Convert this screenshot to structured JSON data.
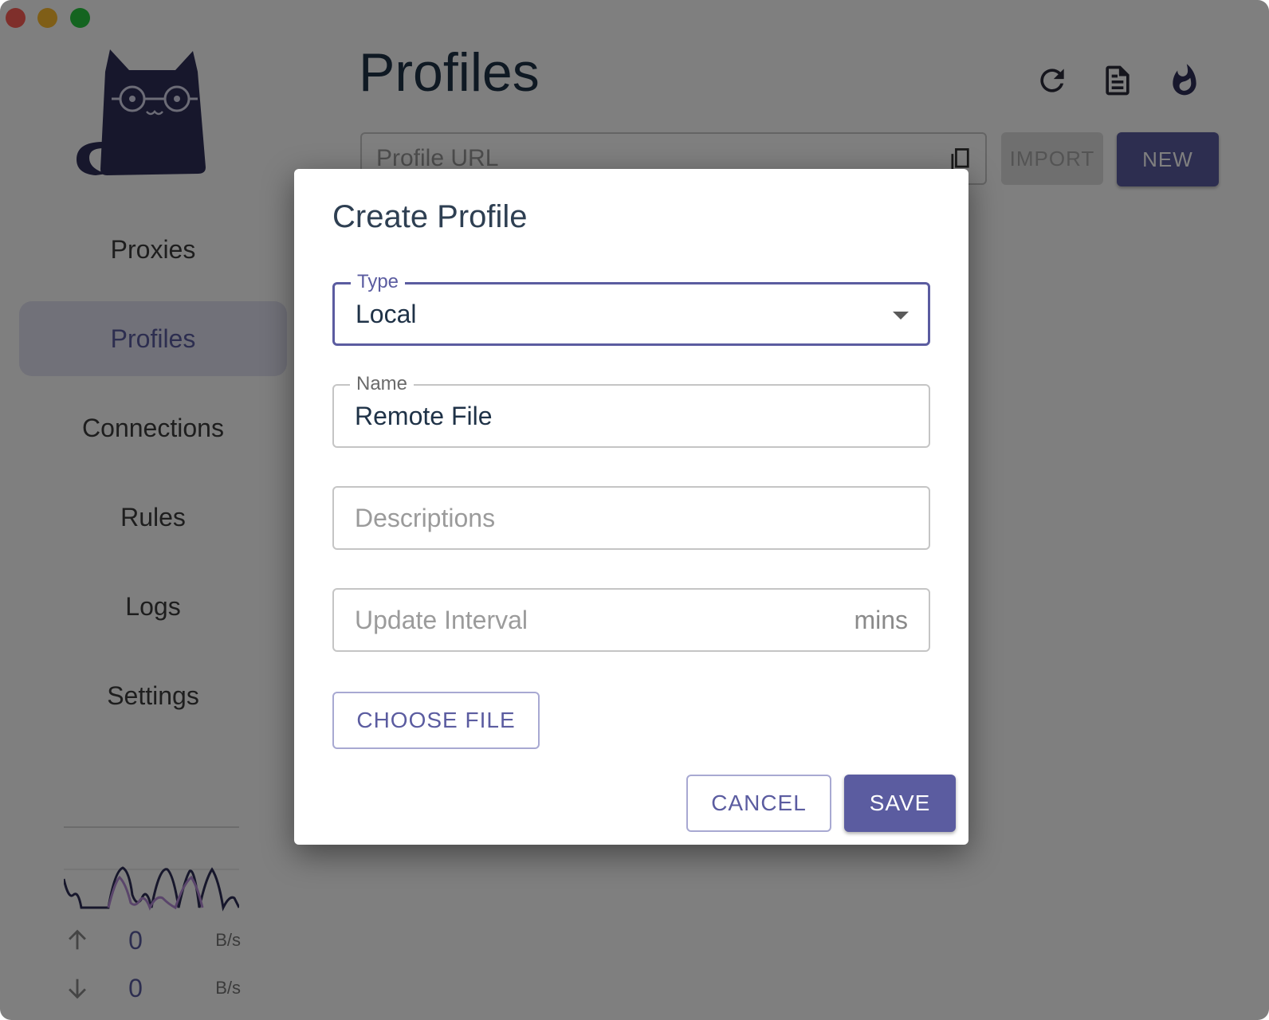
{
  "colors": {
    "accent": "#5b5ca0",
    "sidebar_active_bg": "#e3e3f2",
    "logo": "#2f2f58"
  },
  "sidebar": {
    "logo_icon": "cat-with-glasses-logo",
    "items": [
      {
        "label": "Proxies",
        "active": false
      },
      {
        "label": "Profiles",
        "active": true
      },
      {
        "label": "Connections",
        "active": false
      },
      {
        "label": "Rules",
        "active": false
      },
      {
        "label": "Logs",
        "active": false
      },
      {
        "label": "Settings",
        "active": false
      }
    ],
    "traffic": {
      "upload": {
        "value": "0",
        "unit": "B/s"
      },
      "download": {
        "value": "0",
        "unit": "B/s"
      }
    }
  },
  "header": {
    "title": "Profiles",
    "icons": [
      "refresh-icon",
      "document-icon",
      "fire-icon"
    ]
  },
  "profile_url": {
    "placeholder": "Profile URL",
    "paste_icon": "paste-icon",
    "import_label": "IMPORT",
    "new_label": "NEW"
  },
  "dialog": {
    "title": "Create Profile",
    "type_field": {
      "label": "Type",
      "value": "Local"
    },
    "name_field": {
      "label": "Name",
      "value": "Remote File"
    },
    "descriptions_field": {
      "placeholder": "Descriptions"
    },
    "interval_field": {
      "placeholder": "Update Interval",
      "suffix": "mins"
    },
    "choose_file_label": "CHOOSE FILE",
    "cancel_label": "CANCEL",
    "save_label": "SAVE"
  }
}
